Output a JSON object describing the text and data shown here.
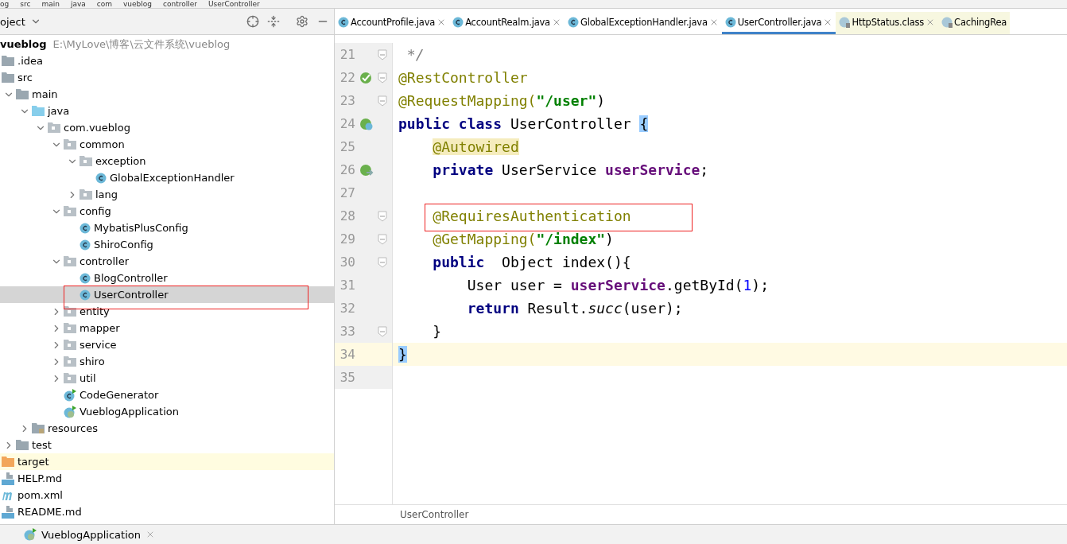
{
  "breadcrumb": [
    "og",
    "src",
    "main",
    "java",
    "com",
    "vueblog",
    "controller",
    "UserController"
  ],
  "project_panel": {
    "title": "oject",
    "tree": [
      {
        "label": "vueblog",
        "path": "E:\\MyLove\\博客\\云文件系统\\vueblog",
        "selected": false,
        "children": [
          {
            "label": ".idea",
            "kind": "folder",
            "selected": false
          },
          {
            "label": "src",
            "kind": "folder",
            "expanded": true,
            "selected": false,
            "children": [
              {
                "label": "main",
                "kind": "folder",
                "expanded": true,
                "selected": false,
                "children": [
                  {
                    "label": "java",
                    "kind": "source-folder",
                    "expanded": true,
                    "selected": false,
                    "children": [
                      {
                        "label": "com.vueblog",
                        "kind": "package",
                        "expanded": true,
                        "selected": false,
                        "children": [
                          {
                            "label": "common",
                            "kind": "package",
                            "expanded": true,
                            "selected": false,
                            "children": [
                              {
                                "label": "exception",
                                "kind": "package",
                                "expanded": true,
                                "selected": false,
                                "children": [
                                  {
                                    "label": "GlobalExceptionHandler",
                                    "kind": "class",
                                    "selected": false
                                  }
                                ]
                              },
                              {
                                "label": "lang",
                                "kind": "package",
                                "expanded": false,
                                "selected": false
                              }
                            ]
                          },
                          {
                            "label": "config",
                            "kind": "package",
                            "expanded": true,
                            "selected": false,
                            "children": [
                              {
                                "label": "MybatisPlusConfig",
                                "kind": "class",
                                "selected": false
                              },
                              {
                                "label": "ShiroConfig",
                                "kind": "class",
                                "selected": false
                              }
                            ]
                          },
                          {
                            "label": "controller",
                            "kind": "package",
                            "expanded": true,
                            "selected": false,
                            "children": [
                              {
                                "label": "BlogController",
                                "kind": "class",
                                "selected": false
                              },
                              {
                                "label": "UserController",
                                "kind": "class",
                                "selected": true,
                                "marked": true
                              }
                            ]
                          },
                          {
                            "label": "entity",
                            "kind": "package",
                            "expanded": false,
                            "selected": false
                          },
                          {
                            "label": "mapper",
                            "kind": "package",
                            "expanded": false,
                            "selected": false
                          },
                          {
                            "label": "service",
                            "kind": "package",
                            "expanded": false,
                            "selected": false
                          },
                          {
                            "label": "shiro",
                            "kind": "package",
                            "expanded": false,
                            "selected": false
                          },
                          {
                            "label": "util",
                            "kind": "package",
                            "expanded": false,
                            "selected": false
                          },
                          {
                            "label": "CodeGenerator",
                            "kind": "runnable-class",
                            "selected": false
                          },
                          {
                            "label": "VueblogApplication",
                            "kind": "spring-app",
                            "selected": false
                          }
                        ]
                      }
                    ]
                  },
                  {
                    "label": "resources",
                    "kind": "resource-folder",
                    "expanded": false,
                    "selected": false
                  }
                ]
              },
              {
                "label": "test",
                "kind": "folder",
                "expanded": false,
                "selected": false
              }
            ]
          },
          {
            "label": "target",
            "kind": "excluded-folder",
            "selected": false
          },
          {
            "label": "HELP.md",
            "kind": "markdown",
            "selected": false
          },
          {
            "label": "pom.xml",
            "kind": "maven",
            "selected": false
          },
          {
            "label": "README.md",
            "kind": "markdown",
            "selected": false
          }
        ]
      }
    ]
  },
  "tabs": [
    {
      "label": "AccountProfile.java",
      "kind": "class",
      "selected": false
    },
    {
      "label": "AccountRealm.java",
      "kind": "class",
      "selected": false
    },
    {
      "label": "GlobalExceptionHandler.java",
      "kind": "class",
      "selected": false
    },
    {
      "label": "UserController.java",
      "kind": "class",
      "selected": true
    },
    {
      "label": "HttpStatus.class",
      "kind": "enum-file",
      "selected": false
    },
    {
      "label": "CachingRea",
      "kind": "class-file",
      "selected": false
    }
  ],
  "code_lines": [
    {
      "number": "21",
      "fold": true,
      "current": false,
      "marked": false,
      "tokens": [
        {
          "text": " */",
          "kind": "comment"
        }
      ]
    },
    {
      "number": "22",
      "fold": true,
      "gutter_icon": {
        "kind": "bean-check"
      },
      "current": false,
      "marked": false,
      "tokens": [
        {
          "text": "@RestController",
          "kind": "annotation"
        }
      ]
    },
    {
      "number": "23",
      "fold": true,
      "current": false,
      "marked": false,
      "tokens": [
        {
          "text": "@RequestMapping(",
          "kind": "annotation"
        },
        {
          "text": "\"/user\"",
          "kind": "string"
        },
        {
          "text": ")",
          "kind": "plain"
        }
      ]
    },
    {
      "number": "24",
      "fold": false,
      "gutter_icon": {
        "kind": "bean-class"
      },
      "current": false,
      "marked": false,
      "tokens": [
        {
          "text": "public class ",
          "kind": "keyword"
        },
        {
          "text": "UserController ",
          "kind": "plain"
        },
        {
          "text": "{",
          "kind": "plain",
          "brace_match": true
        }
      ]
    },
    {
      "number": "25",
      "fold": false,
      "current": false,
      "marked": false,
      "tokens": [
        {
          "text": "    @Autowired",
          "kind": "annotation",
          "usage_highlight": true
        }
      ]
    },
    {
      "number": "26",
      "fold": false,
      "gutter_icon": {
        "kind": "bean-inject"
      },
      "current": false,
      "marked": false,
      "tokens": [
        {
          "text": "    private ",
          "kind": "keyword"
        },
        {
          "text": "UserService ",
          "kind": "plain"
        },
        {
          "text": "userService",
          "kind": "field"
        },
        {
          "text": ";",
          "kind": "plain"
        }
      ]
    },
    {
      "number": "27",
      "fold": false,
      "current": false,
      "marked": false
    },
    {
      "number": "28",
      "fold": true,
      "current": false,
      "marked": true,
      "tokens": [
        {
          "text": "    @RequiresAuthentication",
          "kind": "annotation"
        }
      ]
    },
    {
      "number": "29",
      "fold": true,
      "current": false,
      "marked": false,
      "tokens": [
        {
          "text": "    @GetMapping(",
          "kind": "annotation"
        },
        {
          "text": "\"/index\"",
          "kind": "string"
        },
        {
          "text": ")",
          "kind": "plain"
        }
      ]
    },
    {
      "number": "30",
      "fold": true,
      "current": false,
      "marked": false,
      "tokens": [
        {
          "text": "    public  ",
          "kind": "keyword"
        },
        {
          "text": "Object index(){",
          "kind": "plain"
        }
      ]
    },
    {
      "number": "31",
      "fold": false,
      "current": false,
      "marked": false,
      "tokens": [
        {
          "text": "        User user = ",
          "kind": "plain"
        },
        {
          "text": "userService",
          "kind": "field"
        },
        {
          "text": ".getById(",
          "kind": "plain"
        },
        {
          "text": "1",
          "kind": "number"
        },
        {
          "text": ");",
          "kind": "plain"
        }
      ]
    },
    {
      "number": "32",
      "fold": false,
      "current": false,
      "marked": false,
      "tokens": [
        {
          "text": "        return ",
          "kind": "keyword"
        },
        {
          "text": "Result.",
          "kind": "plain"
        },
        {
          "text": "succ",
          "kind": "static-call"
        },
        {
          "text": "(user);",
          "kind": "plain"
        }
      ]
    },
    {
      "number": "33",
      "fold": true,
      "current": false,
      "marked": false,
      "tokens": [
        {
          "text": "    }",
          "kind": "plain"
        }
      ]
    },
    {
      "number": "34",
      "fold": false,
      "current": true,
      "marked": false,
      "tokens": [
        {
          "text": "}",
          "kind": "plain",
          "brace_match": true
        }
      ]
    },
    {
      "number": "35",
      "fold": false,
      "current": false,
      "marked": false
    }
  ],
  "editor_breadcrumb": "UserController",
  "run_tabs": [
    {
      "label": "VueblogApplication",
      "selected": false
    }
  ]
}
